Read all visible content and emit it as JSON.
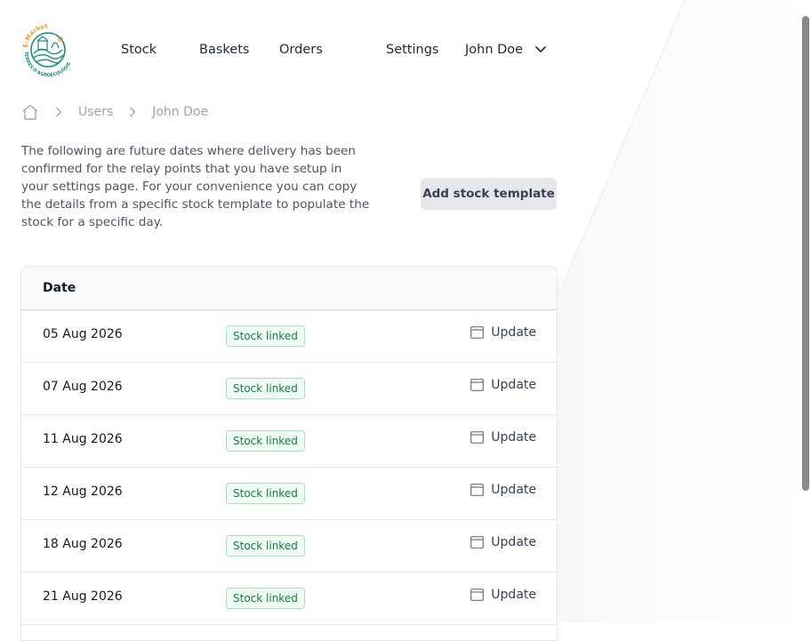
{
  "colors": {
    "brand_green": "#1a8a7a",
    "brand_orange": "#e8a23a",
    "badge_green": "#15803d",
    "button_bg": "#e5e7eb"
  },
  "logo": {
    "top_text": "E-Market",
    "bottom_text": "TERRES D'AGROÉCOLOGIE"
  },
  "nav": {
    "items": [
      {
        "label": "Stock"
      },
      {
        "label": "Baskets"
      },
      {
        "label": "Orders"
      },
      {
        "label": "Settings"
      }
    ],
    "user_name": "John Doe",
    "user_menu_icon": "chevron-down-icon"
  },
  "breadcrumb": {
    "home_icon": "home-icon",
    "items": [
      {
        "label": "Users"
      },
      {
        "label": "John Doe"
      }
    ]
  },
  "intro_text": "The following are future dates where delivery has been confirmed for the relay points that you have setup in your settings page. For your convenience you can copy the details from a specific stock template to populate the stock for a specific day.",
  "add_button_label": "Add stock template",
  "table": {
    "header_date": "Date",
    "rows": [
      {
        "date": "05 Aug 2026",
        "status": "Stock linked",
        "action": "Update"
      },
      {
        "date": "07 Aug 2026",
        "status": "Stock linked",
        "action": "Update"
      },
      {
        "date": "11 Aug 2026",
        "status": "Stock linked",
        "action": "Update"
      },
      {
        "date": "12 Aug 2026",
        "status": "Stock linked",
        "action": "Update"
      },
      {
        "date": "18 Aug 2026",
        "status": "Stock linked",
        "action": "Update"
      },
      {
        "date": "21 Aug 2026",
        "status": "Stock linked",
        "action": "Update"
      }
    ]
  }
}
